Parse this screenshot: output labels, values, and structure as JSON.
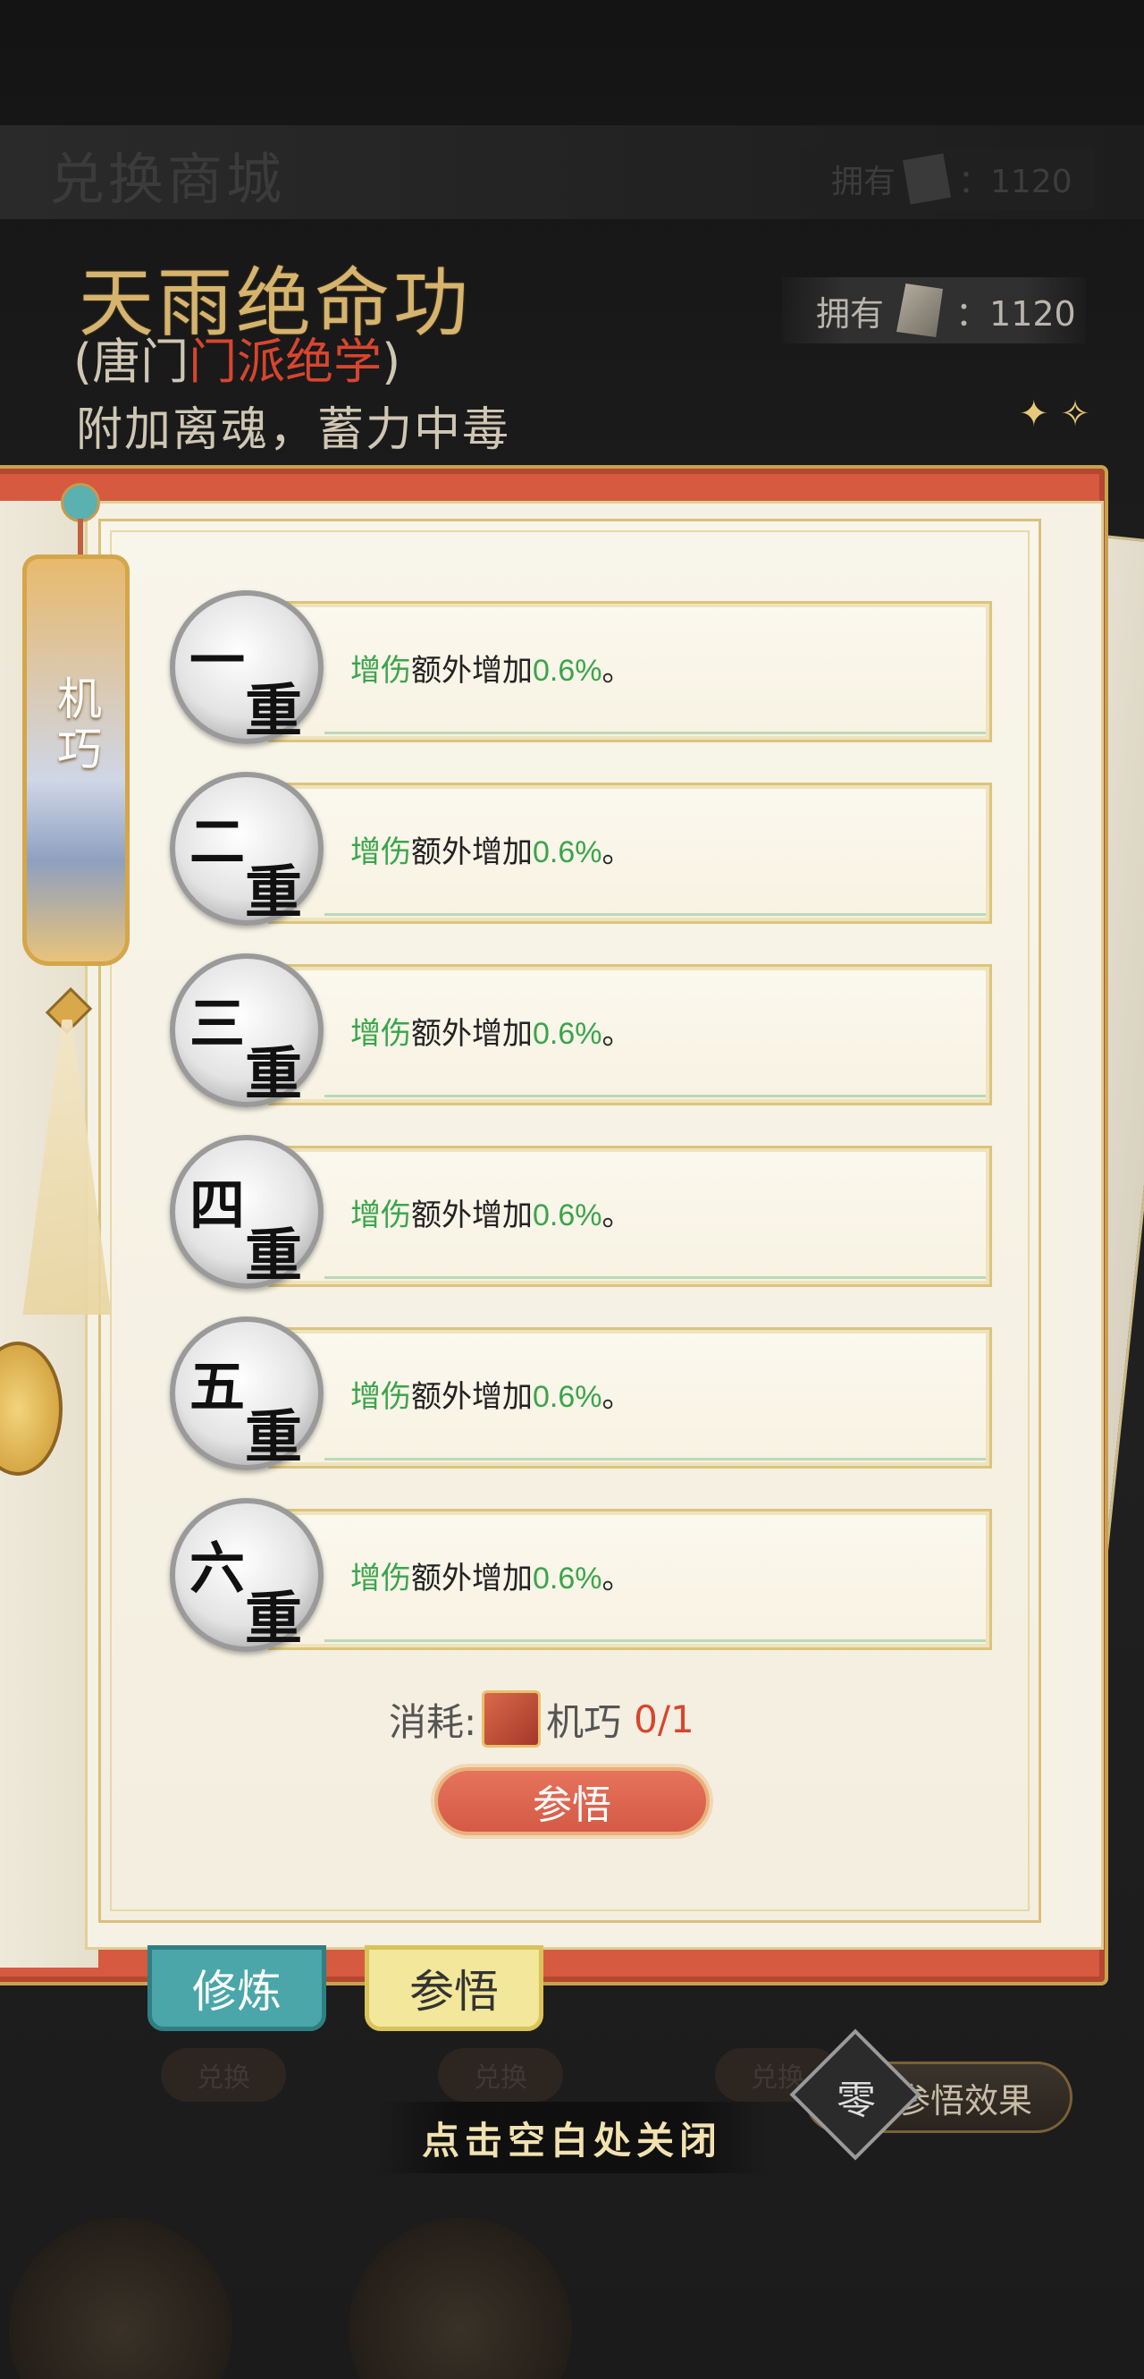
{
  "background": {
    "shop_title": "兑换商城",
    "owned_label": "拥有",
    "owned_value": "：1120",
    "exchange_label": "兑换"
  },
  "skill": {
    "name": "天雨绝命功",
    "sect_open": "(唐门",
    "sect_tag": "门派绝学",
    "sect_close": ")",
    "effect": "附加离魂，蓄力中毒"
  },
  "owned": {
    "label": "拥有",
    "value": "：1120"
  },
  "banner": {
    "label": "机巧"
  },
  "levels": [
    {
      "n1": "一",
      "n2": "重",
      "key": "增伤",
      "text": "额外增加",
      "value": "0.6%",
      "end": "。"
    },
    {
      "n1": "二",
      "n2": "重",
      "key": "增伤",
      "text": "额外增加",
      "value": "0.6%",
      "end": "。"
    },
    {
      "n1": "三",
      "n2": "重",
      "key": "增伤",
      "text": "额外增加",
      "value": "0.6%",
      "end": "。"
    },
    {
      "n1": "四",
      "n2": "重",
      "key": "增伤",
      "text": "额外增加",
      "value": "0.6%",
      "end": "。"
    },
    {
      "n1": "五",
      "n2": "重",
      "key": "增伤",
      "text": "额外增加",
      "value": "0.6%",
      "end": "。"
    },
    {
      "n1": "六",
      "n2": "重",
      "key": "增伤",
      "text": "额外增加",
      "value": "0.6%",
      "end": "。"
    }
  ],
  "cost": {
    "label": "消耗:",
    "item": "机巧",
    "count": "0/1"
  },
  "comprehend_button": "参悟",
  "tabs": {
    "cultivate": "修炼",
    "comprehend": "参悟"
  },
  "close_hint": "点击空白处关闭",
  "effect_button": {
    "badge": "零",
    "label": "参悟效果"
  }
}
